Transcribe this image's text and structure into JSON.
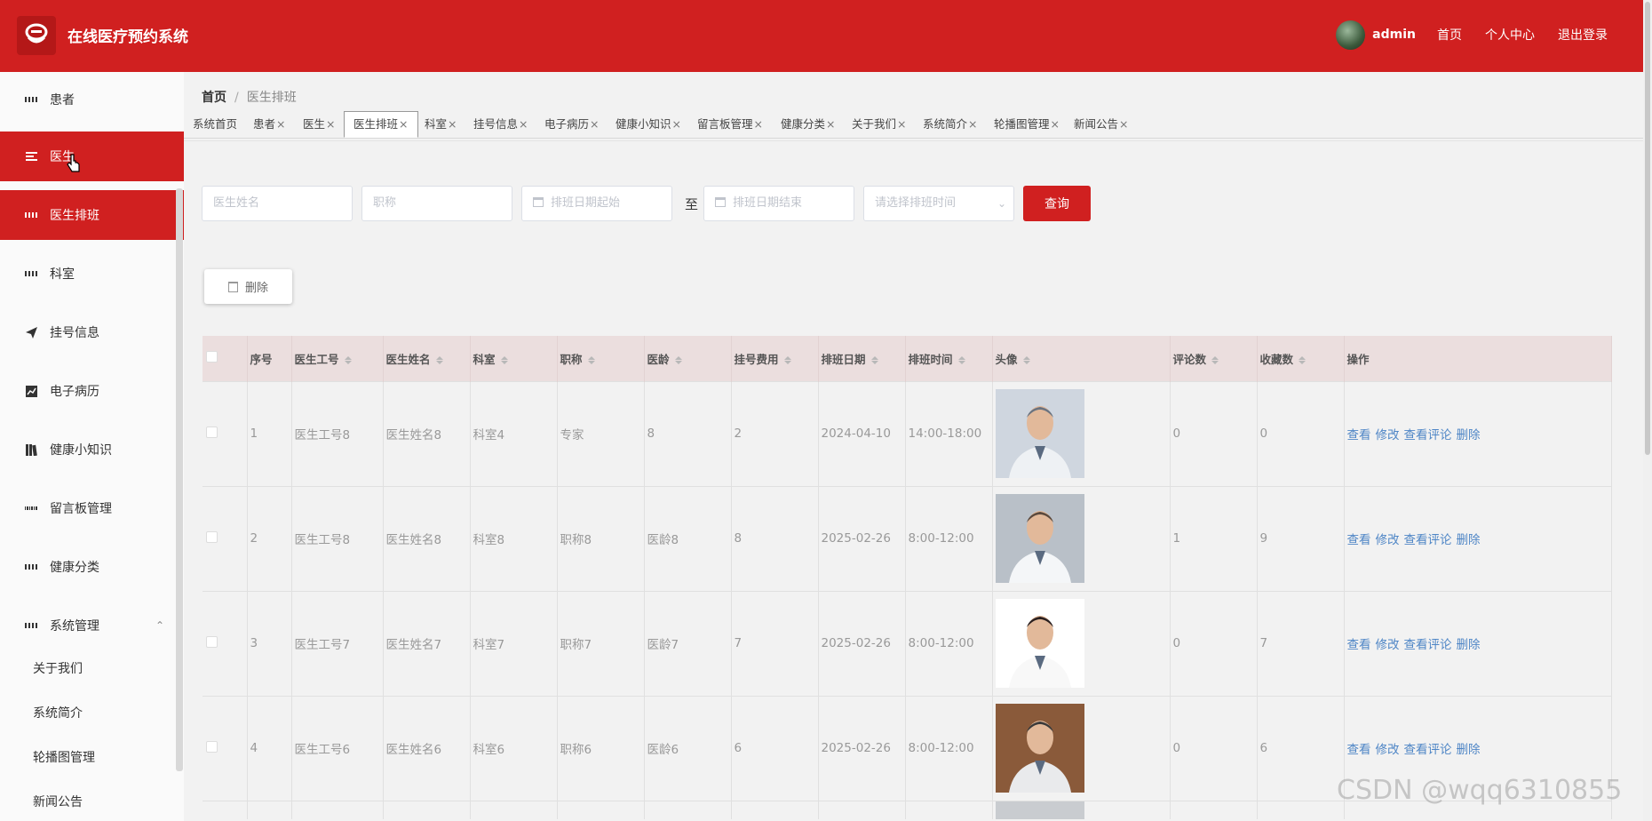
{
  "header": {
    "title": "在线医疗预约系统",
    "username": "admin",
    "links": [
      "首页",
      "个人中心",
      "退出登录"
    ]
  },
  "sidebar": {
    "items": [
      {
        "label": "患者",
        "icon": "grid-icon"
      },
      {
        "label": "医生",
        "icon": "list-icon"
      },
      {
        "label": "医生排班",
        "icon": "grid-icon"
      },
      {
        "label": "科室",
        "icon": "grid-icon"
      },
      {
        "label": "挂号信息",
        "icon": "send-icon"
      },
      {
        "label": "电子病历",
        "icon": "chart-icon"
      },
      {
        "label": "健康小知识",
        "icon": "book-icon"
      },
      {
        "label": "留言板管理",
        "icon": "grid9-icon"
      },
      {
        "label": "健康分类",
        "icon": "grid-icon"
      },
      {
        "label": "系统管理",
        "icon": "grid-icon"
      }
    ],
    "sub_items": [
      "关于我们",
      "系统简介",
      "轮播图管理",
      "新闻公告"
    ]
  },
  "breadcrumb": {
    "home": "首页",
    "separator": "/",
    "current": "医生排班"
  },
  "tabs": [
    "系统首页",
    "患者",
    "医生",
    "医生排班",
    "科室",
    "挂号信息",
    "电子病历",
    "健康小知识",
    "留言板管理",
    "健康分类",
    "关于我们",
    "系统简介",
    "轮播图管理",
    "新闻公告"
  ],
  "tab_close": "×",
  "search": {
    "doctor_name_placeholder": "医生姓名",
    "title_placeholder": "职称",
    "date_start_placeholder": "排班日期起始",
    "date_to": "至",
    "date_end_placeholder": "排班日期结束",
    "time_placeholder": "请选择排班时间",
    "query_label": "查询"
  },
  "toolbar": {
    "delete_label": "删除"
  },
  "table": {
    "columns": [
      "序号",
      "医生工号",
      "医生姓名",
      "科室",
      "职称",
      "医龄",
      "挂号费用",
      "排班日期",
      "排班时间",
      "头像",
      "评论数",
      "收藏数",
      "操作"
    ],
    "actions": [
      "查看",
      "修改",
      "查看评论",
      "删除"
    ],
    "rows": [
      {
        "no": "1",
        "doc_id": "医生工号8",
        "doc_name": "医生姓名8",
        "dept": "科室4",
        "title": "专家",
        "years": "8",
        "fee": "2",
        "date": "2024-04-10",
        "time": "14:00-18:00",
        "comments": "0",
        "favorites": "0"
      },
      {
        "no": "2",
        "doc_id": "医生工号8",
        "doc_name": "医生姓名8",
        "dept": "科室8",
        "title": "职称8",
        "years": "医龄8",
        "fee": "8",
        "date": "2025-02-26",
        "time": "8:00-12:00",
        "comments": "1",
        "favorites": "9"
      },
      {
        "no": "3",
        "doc_id": "医生工号7",
        "doc_name": "医生姓名7",
        "dept": "科室7",
        "title": "职称7",
        "years": "医龄7",
        "fee": "7",
        "date": "2025-02-26",
        "time": "8:00-12:00",
        "comments": "0",
        "favorites": "7"
      },
      {
        "no": "4",
        "doc_id": "医生工号6",
        "doc_name": "医生姓名6",
        "dept": "科室6",
        "title": "职称6",
        "years": "医龄6",
        "fee": "6",
        "date": "2025-02-26",
        "time": "8:00-12:00",
        "comments": "0",
        "favorites": "6"
      }
    ]
  },
  "watermark": "CSDN @wqq6310855",
  "colors": {
    "primary": "#d02020",
    "link": "#4f86c6",
    "table_header": "#ebdede"
  }
}
